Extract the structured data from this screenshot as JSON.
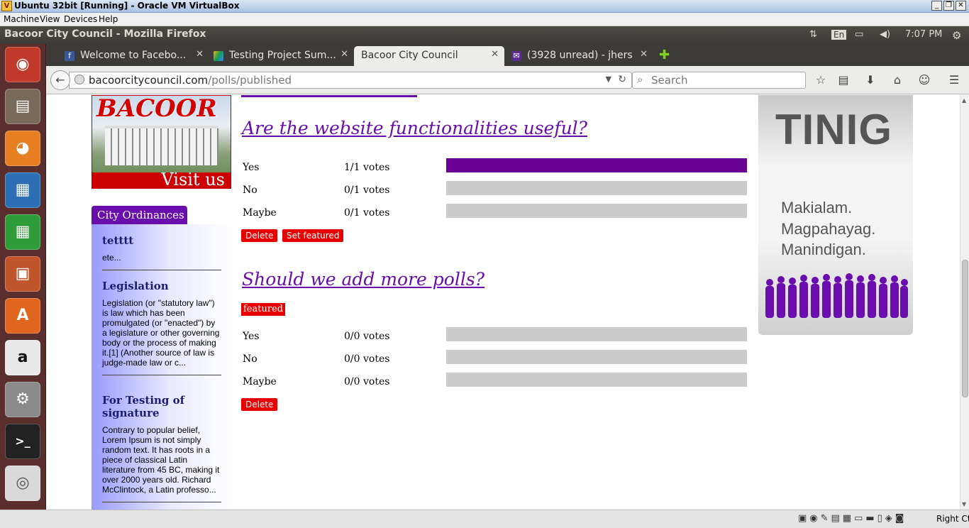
{
  "vbox": {
    "window_title": "Ubuntu 32bit [Running] - Oracle VM VirtualBox",
    "menu": [
      "Machine",
      "View",
      "Devices",
      "Help"
    ],
    "hostkey": "Right Ctrl"
  },
  "ubuntu": {
    "window_title": "Bacoor City Council - Mozilla Firefox",
    "keyboard": "En",
    "time": "7:07 PM"
  },
  "tabs": [
    {
      "label": "Welcome to Facebo...",
      "icon": "facebook-icon"
    },
    {
      "label": "Testing Project Sum...",
      "icon": "google-drive-icon"
    },
    {
      "label": "Bacoor City Council",
      "icon": "none",
      "active": true
    },
    {
      "label": "(3928 unread) - jhers...",
      "icon": "mail-icon"
    }
  ],
  "nav": {
    "url_host": "bacoorcitycouncil.com",
    "url_path": "/polls/published",
    "search_placeholder": "Search"
  },
  "sidebar": {
    "banner_title": "BACOOR",
    "banner_visit": "Visit us",
    "ordinances_header": "City Ordinances",
    "ordinances": [
      {
        "title": "tetttt",
        "excerpt": "ete..."
      },
      {
        "title": "Legislation",
        "excerpt": "Legislation (or \"statutory law\") is law which has been promulgated (or \"enacted\") by a legislature or other governing body or the process of making it.[1] (Another source of law is judge-made law or c..."
      },
      {
        "title": "For Testing of signature",
        "excerpt": "Contrary to popular belief, Lorem Ipsum is not simply random text. It has roots in a piece of classical Latin literature from 45 BC, making it over 2000 years old. Richard McClintock, a Latin professo..."
      }
    ]
  },
  "polls": [
    {
      "question": "Are the website functionalities useful?",
      "featured_label": "",
      "options": [
        {
          "label": "Yes",
          "votes": "1/1 votes",
          "fraction": 1.0
        },
        {
          "label": "No",
          "votes": "0/1 votes",
          "fraction": 0.0
        },
        {
          "label": "Maybe",
          "votes": "0/1 votes",
          "fraction": 0.0
        }
      ],
      "buttons": [
        "Delete",
        "Set featured"
      ]
    },
    {
      "question": "Should we add more polls?",
      "featured_label": "featured",
      "options": [
        {
          "label": "Yes",
          "votes": "0/0 votes",
          "fraction": 0.0
        },
        {
          "label": "No",
          "votes": "0/0 votes",
          "fraction": 0.0
        },
        {
          "label": "Maybe",
          "votes": "0/0 votes",
          "fraction": 0.0
        }
      ],
      "buttons": [
        "Delete"
      ]
    }
  ],
  "ad": {
    "brand": "TINIG",
    "lines": [
      "Makialam.",
      "Magpahayag.",
      "Manindigan."
    ]
  },
  "colors": {
    "accent_purple": "#6a0dad",
    "button_red": "#e60000",
    "bar_empty": "#cccccc"
  }
}
